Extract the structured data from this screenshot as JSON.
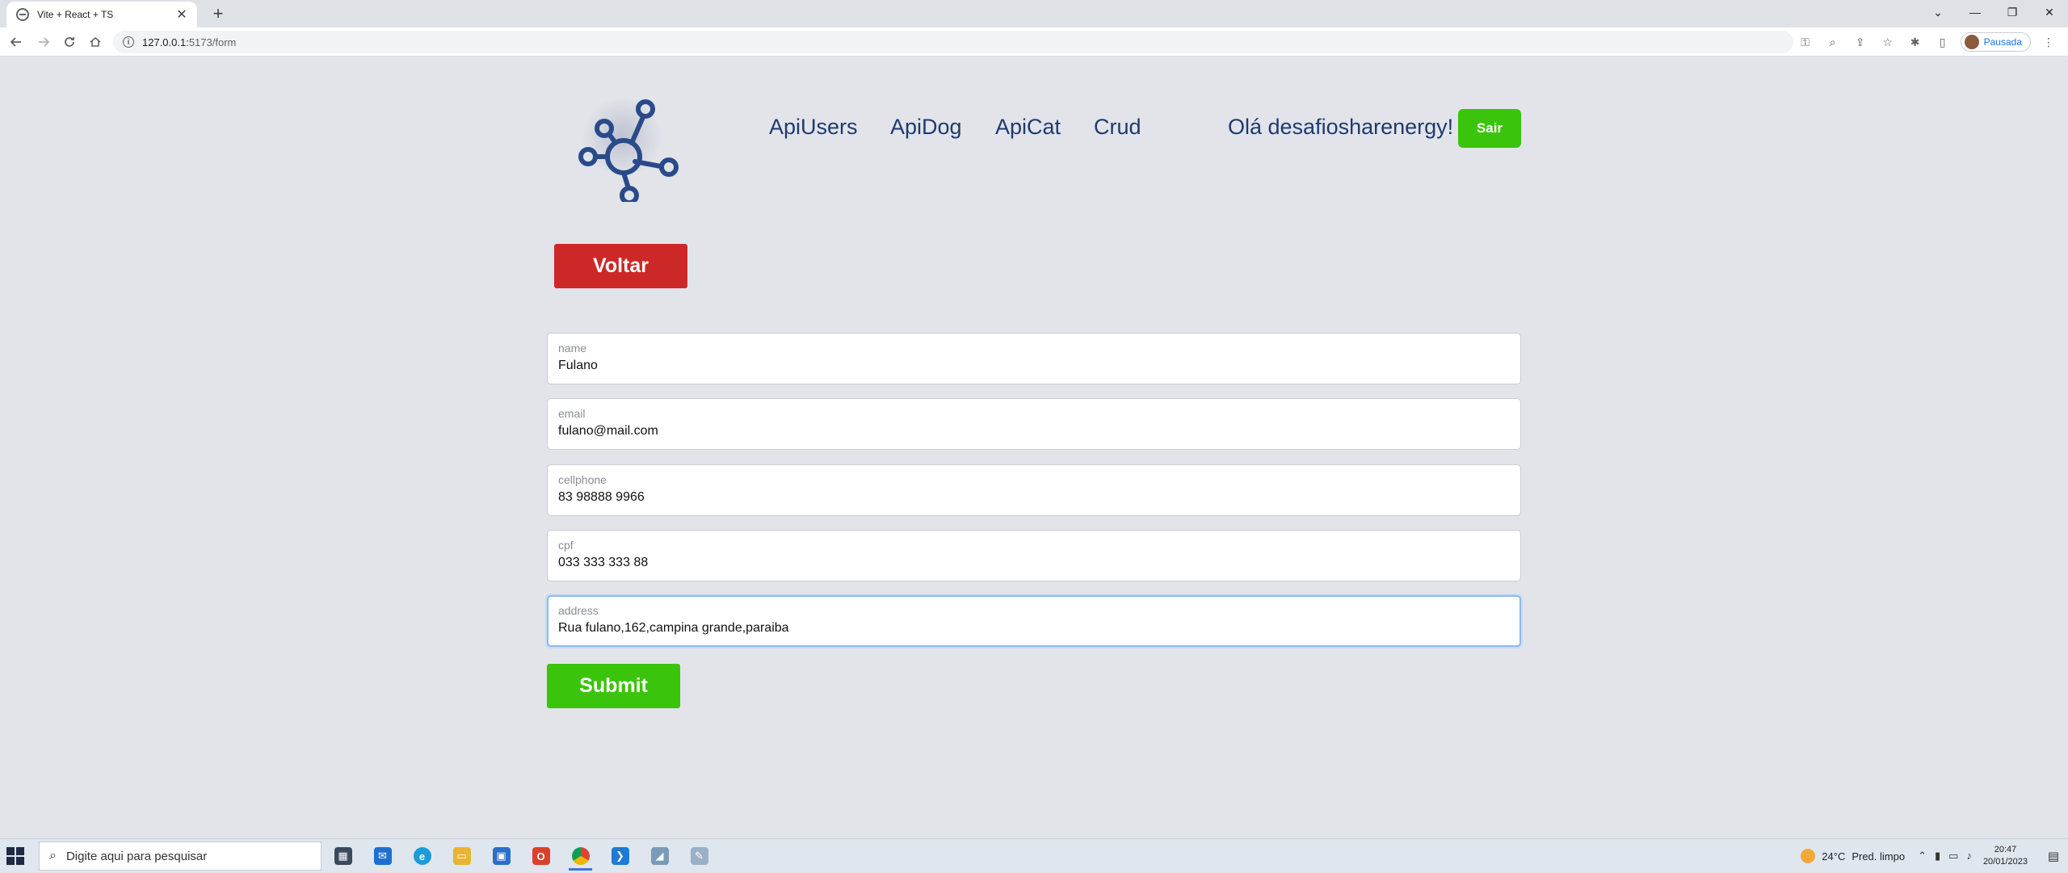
{
  "browser": {
    "tab_title": "Vite + React + TS",
    "tab_close": "✕",
    "new_tab": "+",
    "url_host": "127.0.0.1:",
    "url_path": "5173/form",
    "profile_label": "Pausada",
    "window_controls": [
      "⌄",
      "—",
      "❐",
      "✕"
    ]
  },
  "header": {
    "nav": [
      "ApiUsers",
      "ApiDog",
      "ApiCat",
      "Crud"
    ],
    "greeting": "Olá desafiosharenergy!",
    "logout_label": "Sair",
    "logo_color": "#2a4a8a"
  },
  "back_label": "Voltar",
  "form": {
    "fields": [
      {
        "label": "name",
        "value": "Fulano"
      },
      {
        "label": "email",
        "value": "fulano@mail.com"
      },
      {
        "label": "cellphone",
        "value": "83 98888 9966"
      },
      {
        "label": "cpf",
        "value": "033 333 333 88"
      },
      {
        "label": "address",
        "value": "Rua fulano,162,campina grande,paraiba"
      }
    ],
    "submit_label": "Submit"
  },
  "colors": {
    "green": "#3ac40c",
    "red": "#cc2828",
    "nav_text": "#1f3a6e"
  },
  "taskbar": {
    "search_placeholder": "Digite aqui para pesquisar",
    "weather_temp": "24°C",
    "weather_desc": "Pred. limpo",
    "time": "20:47",
    "date": "20/01/2023"
  }
}
